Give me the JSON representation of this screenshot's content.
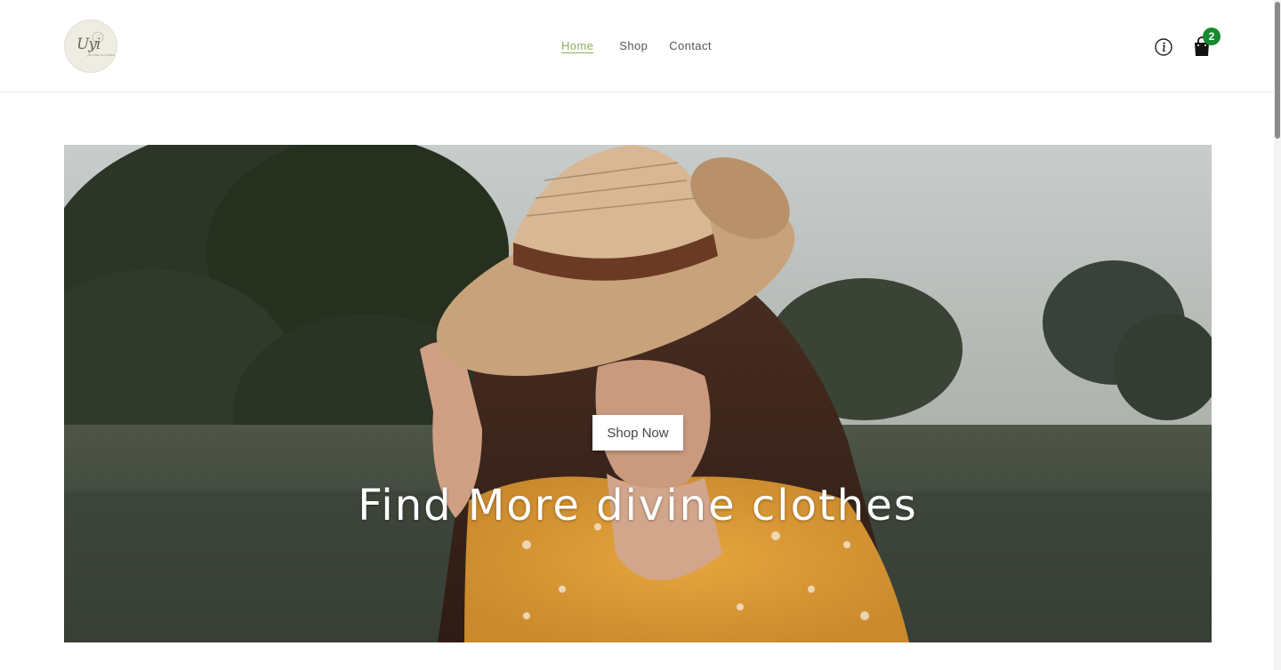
{
  "brand": {
    "logo_text": "Uyi",
    "logo_subtext": "DIVINE CLOTHES"
  },
  "nav": {
    "items": [
      {
        "label": "Home",
        "active": true
      },
      {
        "label": "Shop",
        "active": false
      },
      {
        "label": "Contact",
        "active": false
      }
    ]
  },
  "header_actions": {
    "info_icon": "info-circle-icon",
    "cart_icon": "shopping-bag-icon",
    "cart_count": "2"
  },
  "hero": {
    "title": "Find More divine clothes",
    "cta_label": "Shop Now",
    "image_description_icon": "hero-photo"
  },
  "colors": {
    "accent": "#8fae5f",
    "badge": "#178a2f",
    "text": "#555555",
    "background": "#ffffff"
  }
}
